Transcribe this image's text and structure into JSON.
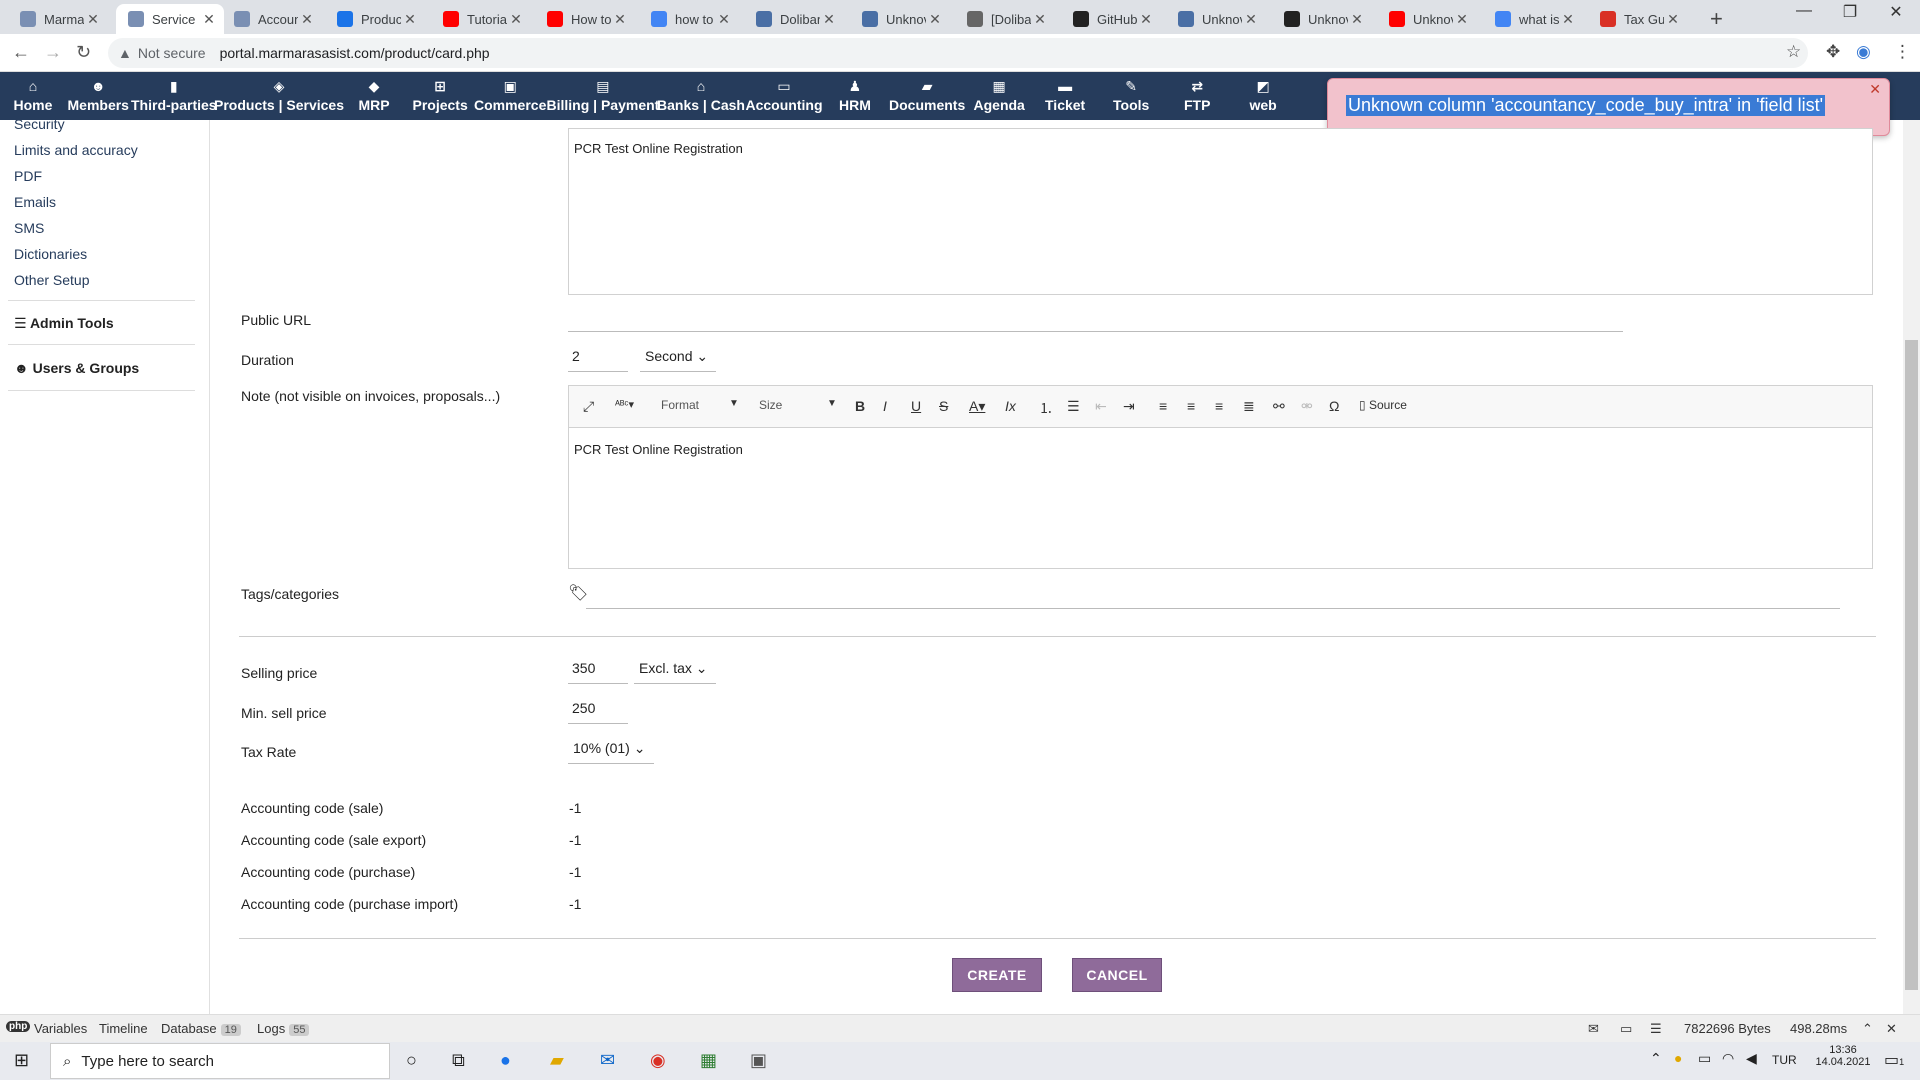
{
  "browser": {
    "tabs": [
      {
        "label": "Marmar",
        "color": "#7a8fb3"
      },
      {
        "label": "Service",
        "color": "#7a8fb3"
      },
      {
        "label": "Accoun",
        "color": "#7a8fb3"
      },
      {
        "label": "Product",
        "color": "#1a73e8"
      },
      {
        "label": "Tutorial",
        "color": "#ff0000"
      },
      {
        "label": "How to",
        "color": "#ff0000"
      },
      {
        "label": "how to",
        "color": "#4285f4"
      },
      {
        "label": "Doliban",
        "color": "#4a6fa5"
      },
      {
        "label": "Unknov",
        "color": "#4a6fa5"
      },
      {
        "label": "[Doliba",
        "color": "#666666"
      },
      {
        "label": "GitHub",
        "color": "#222222"
      },
      {
        "label": "Unknov",
        "color": "#4a6fa5"
      },
      {
        "label": "Unknov",
        "color": "#222222"
      },
      {
        "label": "Unknov",
        "color": "#ff0000"
      },
      {
        "label": "what is",
        "color": "#4285f4"
      },
      {
        "label": "Tax Gui",
        "color": "#d93025"
      }
    ],
    "not_secure": "Not secure",
    "url": "portal.marmarasasist.com/product/card.php"
  },
  "topmenu": [
    {
      "label": "Home",
      "icon": "home-icon",
      "glyph": "⌂"
    },
    {
      "label": "Members",
      "icon": "members-icon",
      "glyph": "☻"
    },
    {
      "label": "Third-parties",
      "icon": "building-icon",
      "glyph": "▮"
    },
    {
      "label": "Products | Services",
      "icon": "cube-icon",
      "glyph": "◈"
    },
    {
      "label": "MRP",
      "icon": "cubes-icon",
      "glyph": "◆"
    },
    {
      "label": "Projects",
      "icon": "sitemap-icon",
      "glyph": "⊞"
    },
    {
      "label": "Commerce",
      "icon": "suitcase-icon",
      "glyph": "▣"
    },
    {
      "label": "Billing | Payment",
      "icon": "money-icon",
      "glyph": "▤"
    },
    {
      "label": "Banks | Cash",
      "icon": "bank-icon",
      "glyph": "⌂"
    },
    {
      "label": "Accounting",
      "icon": "ledger-icon",
      "glyph": "▭"
    },
    {
      "label": "HRM",
      "icon": "user-icon",
      "glyph": "♟"
    },
    {
      "label": "Documents",
      "icon": "folder-icon",
      "glyph": "▰"
    },
    {
      "label": "Agenda",
      "icon": "calendar-icon",
      "glyph": "▦"
    },
    {
      "label": "Ticket",
      "icon": "ticket-icon",
      "glyph": "▬"
    },
    {
      "label": "Tools",
      "icon": "wrench-icon",
      "glyph": "✎"
    },
    {
      "label": "FTP",
      "icon": "exchange-icon",
      "glyph": "⇄"
    },
    {
      "label": "web",
      "icon": "external-icon",
      "glyph": "◩"
    }
  ],
  "error": {
    "message": "Unknown column 'accountancy_code_buy_intra' in 'field list'"
  },
  "sidebar": {
    "items": [
      "Security",
      "Limits and accuracy",
      "PDF",
      "Emails",
      "SMS",
      "Dictionaries",
      "Other Setup"
    ],
    "admin_tools": "Admin Tools",
    "users_groups": "Users & Groups"
  },
  "form": {
    "description_text": "PCR Test Online Registration",
    "public_url_label": "Public URL",
    "public_url_value": "",
    "duration_label": "Duration",
    "duration_value": "2",
    "duration_unit": "Second",
    "note_label": "Note (not visible on invoices, proposals...)",
    "editor_format": "Format",
    "editor_size": "Size",
    "editor_source": "Source",
    "note_text": "PCR Test Online Registration",
    "tags_label": "Tags/categories",
    "selling_price_label": "Selling price",
    "selling_price_value": "350",
    "price_base": "Excl. tax",
    "min_price_label": "Min. sell price",
    "min_price_value": "250",
    "tax_label": "Tax Rate",
    "tax_value": "10% (01)",
    "acc_sale_label": "Accounting code (sale)",
    "acc_sale_value": "-1",
    "acc_sale_export_label": "Accounting code (sale export)",
    "acc_sale_export_value": "-1",
    "acc_purchase_label": "Accounting code (purchase)",
    "acc_purchase_value": "-1",
    "acc_purchase_import_label": "Accounting code (purchase import)",
    "acc_purchase_import_value": "-1",
    "create_button": "CREATE",
    "cancel_button": "CANCEL"
  },
  "debugbar": {
    "variables": "Variables",
    "timeline": "Timeline",
    "database": "Database",
    "database_count": "19",
    "logs": "Logs",
    "logs_count": "55",
    "memory": "7822696 Bytes",
    "time": "498.28ms"
  },
  "taskbar": {
    "search_placeholder": "Type here to search",
    "lang": "TUR",
    "clock_time": "13:36",
    "clock_date": "14.04.2021",
    "notif_count": "1"
  }
}
